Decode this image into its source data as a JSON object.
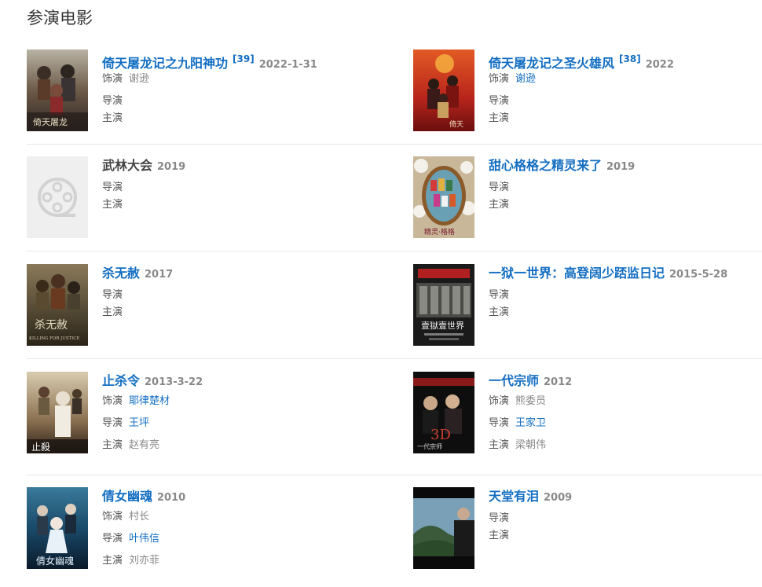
{
  "section_title": "参演电影",
  "labels": {
    "role": "饰演",
    "director": "导演",
    "starring": "主演"
  },
  "movies": [
    {
      "title": "倚天屠龙记之九阳神功",
      "cite": "[39]",
      "date": "2022-1-31",
      "role": "谢逊",
      "director": "",
      "starring": "",
      "poster": "poster-yitian-jiuyang"
    },
    {
      "title": "倚天屠龙记之圣火雄风",
      "cite": "[38]",
      "date": "2022",
      "role": "谢逊",
      "director": "",
      "starring": "",
      "poster": "poster-yitian-shenghuo"
    },
    {
      "title": "武林大会",
      "date": "2019",
      "director": "",
      "starring": "",
      "poster": "poster-placeholder-film-reel-icon"
    },
    {
      "title": "甜心格格之精灵来了",
      "date": "2019",
      "director": "",
      "starring": "",
      "poster": "poster-tianxin-gege"
    },
    {
      "title": "杀无赦",
      "date": "2017",
      "director": "",
      "starring": "",
      "poster": "poster-sha-wu-she"
    },
    {
      "title": "一狱一世界：高登阔少踎监日记",
      "date": "2015-5-28",
      "director": "",
      "starring": "",
      "poster": "poster-yi-yu-yi-shijie"
    },
    {
      "title": "止杀令",
      "date": "2013-3-22",
      "role": "耶律楚材",
      "director": "王坪",
      "starring": "赵有亮",
      "poster": "poster-zhi-sha-ling"
    },
    {
      "title": "一代宗师",
      "date": "2012",
      "role": "熊委员",
      "director": "王家卫",
      "starring": "梁朝伟",
      "poster": "poster-yidai-zongshi"
    },
    {
      "title": "倩女幽魂",
      "date": "2010",
      "role": "村长",
      "director": "叶伟信",
      "starring": "刘亦菲",
      "poster": "poster-qiannv-youhun"
    },
    {
      "title": "天堂有泪",
      "date": "2009",
      "director": "",
      "starring": "",
      "poster": "poster-tiantang-youlei"
    }
  ],
  "poster_text": {
    "yitian_jiuyang": "倚天屠龙",
    "tianxin": "精灵·格格",
    "sha_wu_she_cn": "杀无赦",
    "sha_wu_she_en": "KILLING FOR JUSTICE",
    "yi_yu": "壹獄壹世界",
    "yidai": "一代宗师"
  },
  "colors": {
    "link": "#136ec2",
    "title_plain": "#444444",
    "meta": "#888888",
    "divider": "#e6e6e6"
  }
}
